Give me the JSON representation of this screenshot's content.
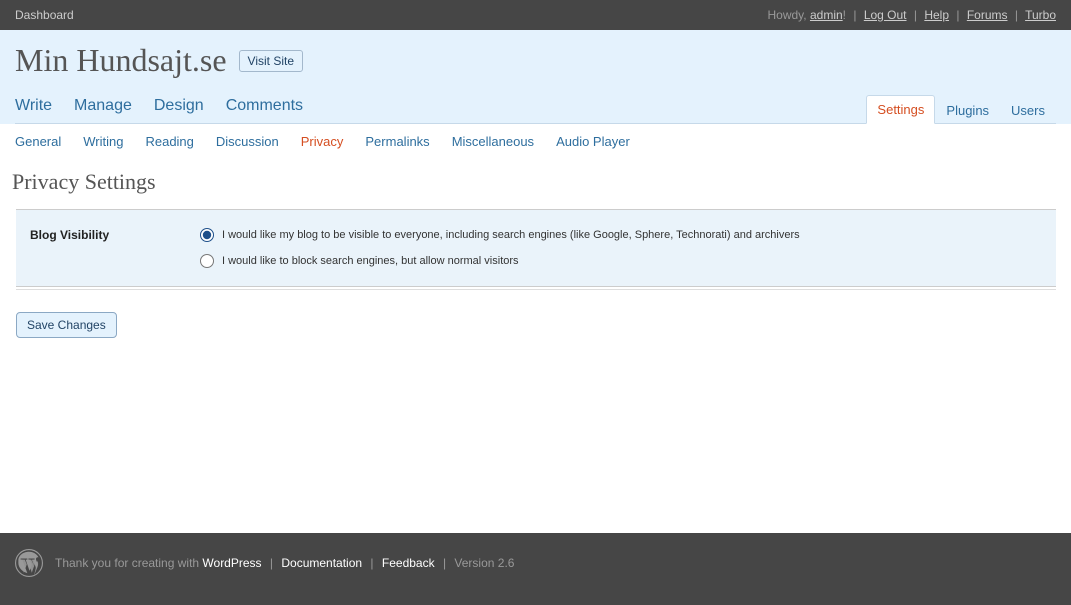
{
  "topbar": {
    "dashboard": "Dashboard",
    "howdy_prefix": "Howdy, ",
    "username": "admin",
    "howdy_suffix": "!",
    "logout": "Log Out",
    "help": "Help",
    "forums": "Forums",
    "turbo": "Turbo"
  },
  "header": {
    "site_title": "Min Hundsajt.se",
    "visit_site": "Visit Site"
  },
  "main_nav": {
    "left": [
      "Write",
      "Manage",
      "Design",
      "Comments"
    ],
    "right": [
      "Settings",
      "Plugins",
      "Users"
    ],
    "right_active": "Settings"
  },
  "sub_nav": {
    "items": [
      "General",
      "Writing",
      "Reading",
      "Discussion",
      "Privacy",
      "Permalinks",
      "Miscellaneous",
      "Audio Player"
    ],
    "current": "Privacy"
  },
  "page": {
    "heading": "Privacy Settings",
    "section_label": "Blog Visibility",
    "options": [
      {
        "text": "I would like my blog to be visible to everyone, including search engines (like Google, Sphere, Technorati) and archivers",
        "checked": true
      },
      {
        "text": "I would like to block search engines, but allow normal visitors",
        "checked": false
      }
    ],
    "save_button": "Save Changes"
  },
  "footer": {
    "thanks": "Thank you for creating with ",
    "wordpress": "WordPress",
    "documentation": "Documentation",
    "feedback": "Feedback",
    "version": "Version 2.6"
  }
}
